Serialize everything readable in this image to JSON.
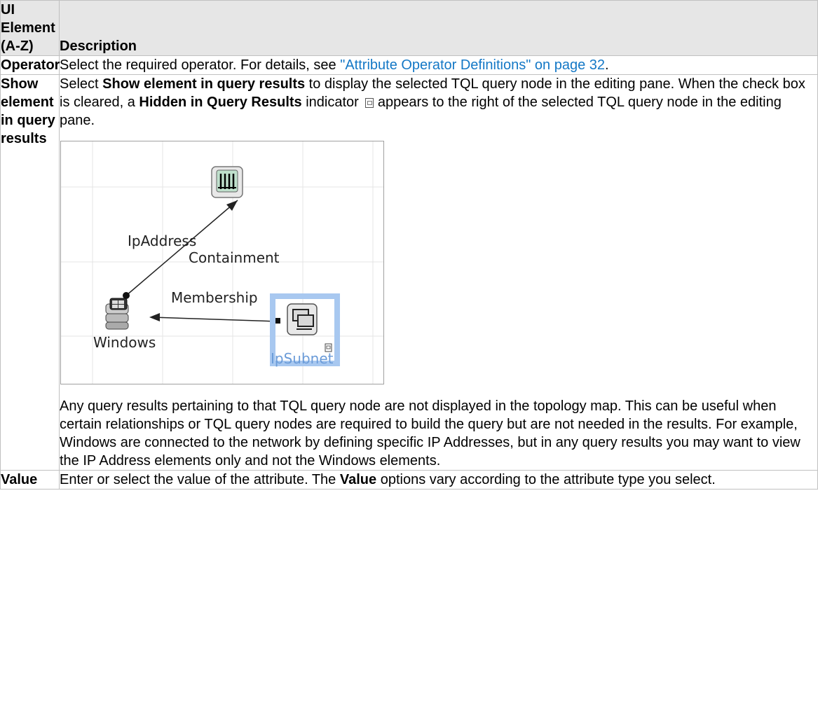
{
  "header": {
    "col1": "UI Element (A-Z)",
    "col2": "Description"
  },
  "rows": [
    {
      "name": "Operator",
      "desc_prefix": "Select the required operator. For details, see ",
      "link": "\"Attribute Operator Definitions\" on page 32",
      "desc_suffix": "."
    },
    {
      "name": "Show element in query results",
      "p1": {
        "t1": "Select ",
        "b1": "Show element in query results",
        "t2": " to display the selected TQL query node in the editing pane. When the check box is cleared, a ",
        "b2": "Hidden in Query Results",
        "t3": " indicator ",
        "t4": " appears to the right of the selected TQL query node in the editing pane."
      },
      "figure": {
        "labels": {
          "ipaddress": "IpAddress",
          "containment": "Containment",
          "membership": "Membership",
          "windows": "Windows",
          "ipsubnet": "IpSubnet"
        },
        "icons": [
          "ip-address-node-icon",
          "windows-node-icon",
          "ip-subnet-node-icon",
          "hidden-indicator-icon"
        ],
        "colors": {
          "selection": "#a8c8f0",
          "selected_label": "#6a9bd8",
          "grid": "#e4e4e4"
        }
      },
      "p2": "Any query results pertaining to that TQL query node are not displayed in the topology map. This can be useful when certain relationships or TQL query nodes are required to build the query but are not needed in the results. For example, Windows are connected to the network by defining specific IP Addresses, but in any query results you may want to view the IP Address elements only and not the Windows elements."
    },
    {
      "name": "Value",
      "t1": "Enter or select the value of the attribute. The ",
      "b1": "Value",
      "t2": " options vary according to the attribute type you select."
    }
  ]
}
